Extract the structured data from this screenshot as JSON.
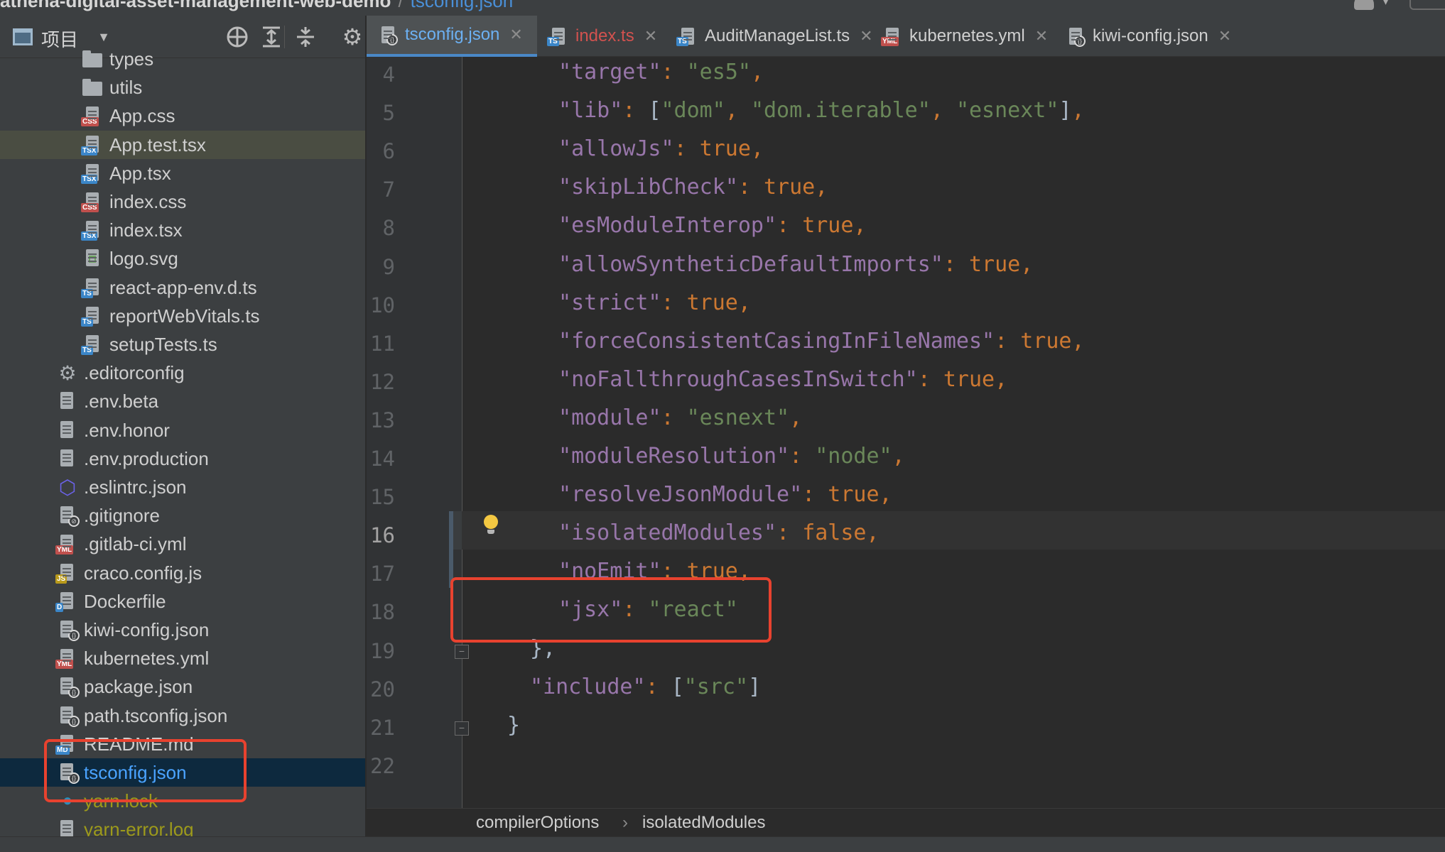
{
  "titlebar": {
    "project_path": "athena-digital-asset-management-web-demo",
    "separator": "/",
    "file": "tsconfig.json"
  },
  "project_panel": {
    "title": "项目",
    "tree": [
      {
        "label": "types",
        "icon": "folder",
        "indent": 2
      },
      {
        "label": "utils",
        "icon": "folder",
        "indent": 2
      },
      {
        "label": "App.css",
        "icon": "css",
        "indent": 2
      },
      {
        "label": "App.test.tsx",
        "icon": "tsx",
        "indent": 2,
        "state": "hover"
      },
      {
        "label": "App.tsx",
        "icon": "tsx",
        "indent": 2
      },
      {
        "label": "index.css",
        "icon": "css",
        "indent": 2
      },
      {
        "label": "index.tsx",
        "icon": "tsx",
        "indent": 2
      },
      {
        "label": "logo.svg",
        "icon": "svg",
        "indent": 2
      },
      {
        "label": "react-app-env.d.ts",
        "icon": "ts",
        "indent": 2
      },
      {
        "label": "reportWebVitals.ts",
        "icon": "ts",
        "indent": 2
      },
      {
        "label": "setupTests.ts",
        "icon": "ts",
        "indent": 2
      },
      {
        "label": ".editorconfig",
        "icon": "gear",
        "indent": 1
      },
      {
        "label": ".env.beta",
        "icon": "text",
        "indent": 1
      },
      {
        "label": ".env.honor",
        "icon": "text",
        "indent": 1
      },
      {
        "label": ".env.production",
        "icon": "text",
        "indent": 1
      },
      {
        "label": ".eslintrc.json",
        "icon": "eslint",
        "indent": 1
      },
      {
        "label": ".gitignore",
        "icon": "ignore",
        "indent": 1
      },
      {
        "label": ".gitlab-ci.yml",
        "icon": "yml",
        "indent": 1
      },
      {
        "label": "craco.config.js",
        "icon": "js",
        "indent": 1
      },
      {
        "label": "Dockerfile",
        "icon": "docker",
        "indent": 1
      },
      {
        "label": "kiwi-config.json",
        "icon": "json",
        "indent": 1
      },
      {
        "label": "kubernetes.yml",
        "icon": "yml",
        "indent": 1
      },
      {
        "label": "package.json",
        "icon": "json",
        "indent": 1
      },
      {
        "label": "path.tsconfig.json",
        "icon": "json",
        "indent": 1
      },
      {
        "label": "README.md",
        "icon": "md",
        "indent": 1
      },
      {
        "label": "tsconfig.json",
        "icon": "json",
        "indent": 1,
        "state": "selected"
      },
      {
        "label": "yarn.lock",
        "icon": "yarn",
        "indent": 1,
        "state": "ignored"
      },
      {
        "label": "yarn-error.log",
        "icon": "text",
        "indent": 1,
        "state": "ignored"
      }
    ]
  },
  "tabs": [
    {
      "label": "tsconfig.json",
      "icon": "json",
      "active": true,
      "close": "✕"
    },
    {
      "label": "index.ts",
      "icon": "ts",
      "error": true,
      "close": "✕"
    },
    {
      "label": "AuditManageList.ts",
      "icon": "ts",
      "close": "✕"
    },
    {
      "label": "kubernetes.yml",
      "icon": "yml",
      "close": "✕"
    },
    {
      "label": "kiwi-config.json",
      "icon": "json",
      "close": "✕"
    }
  ],
  "editor": {
    "current_line": "16",
    "lines": [
      {
        "n": "4",
        "indent": 2,
        "key": "target",
        "value": "\"es5\"",
        "vtype": "str",
        "comma": true
      },
      {
        "n": "5",
        "indent": 2,
        "key": "lib",
        "raw": "[\"dom\", \"dom.iterable\", \"esnext\"]",
        "comma": true
      },
      {
        "n": "6",
        "indent": 2,
        "key": "allowJs",
        "value": "true",
        "vtype": "kw",
        "comma": true
      },
      {
        "n": "7",
        "indent": 2,
        "key": "skipLibCheck",
        "value": "true",
        "vtype": "kw",
        "comma": true
      },
      {
        "n": "8",
        "indent": 2,
        "key": "esModuleInterop",
        "value": "true",
        "vtype": "kw",
        "comma": true
      },
      {
        "n": "9",
        "indent": 2,
        "key": "allowSyntheticDefaultImports",
        "value": "true",
        "vtype": "kw",
        "comma": true
      },
      {
        "n": "10",
        "indent": 2,
        "key": "strict",
        "value": "true",
        "vtype": "kw",
        "comma": true
      },
      {
        "n": "11",
        "indent": 2,
        "key": "forceConsistentCasingInFileNames",
        "value": "true",
        "vtype": "kw",
        "comma": true
      },
      {
        "n": "12",
        "indent": 2,
        "key": "noFallthroughCasesInSwitch",
        "value": "true",
        "vtype": "kw",
        "comma": true
      },
      {
        "n": "13",
        "indent": 2,
        "key": "module",
        "value": "\"esnext\"",
        "vtype": "str",
        "comma": true
      },
      {
        "n": "14",
        "indent": 2,
        "key": "moduleResolution",
        "value": "\"node\"",
        "vtype": "str",
        "comma": true
      },
      {
        "n": "15",
        "indent": 2,
        "key": "resolveJsonModule",
        "value": "true",
        "vtype": "kw",
        "comma": true
      },
      {
        "n": "16",
        "indent": 2,
        "key": "isolatedModules",
        "value": "false",
        "vtype": "kw",
        "comma": true
      },
      {
        "n": "17",
        "indent": 2,
        "key": "noEmit",
        "value": "true",
        "vtype": "kw",
        "comma": true
      },
      {
        "n": "18",
        "indent": 2,
        "key": "jsx",
        "value": "\"react\"",
        "vtype": "str",
        "comma": false
      },
      {
        "n": "19",
        "indent": 1,
        "text": "},",
        "fold": "end"
      },
      {
        "n": "20",
        "indent": 1,
        "key": "include",
        "raw": "[\"src\"]",
        "comma": false
      },
      {
        "n": "21",
        "indent": 0,
        "text": "}",
        "fold": "end"
      },
      {
        "n": "22",
        "indent": 0,
        "text": ""
      }
    ]
  },
  "breadcrumb": {
    "items": [
      "compilerOptions",
      "isolatedModules"
    ],
    "separator": "›"
  },
  "colors": {
    "key": "#9876aa",
    "string": "#6a8759",
    "keyword": "#cc7832",
    "punct": "#a9b7c6",
    "selection": "#0d293e",
    "annotation": "#e8422f",
    "accent": "#4a88c7"
  }
}
